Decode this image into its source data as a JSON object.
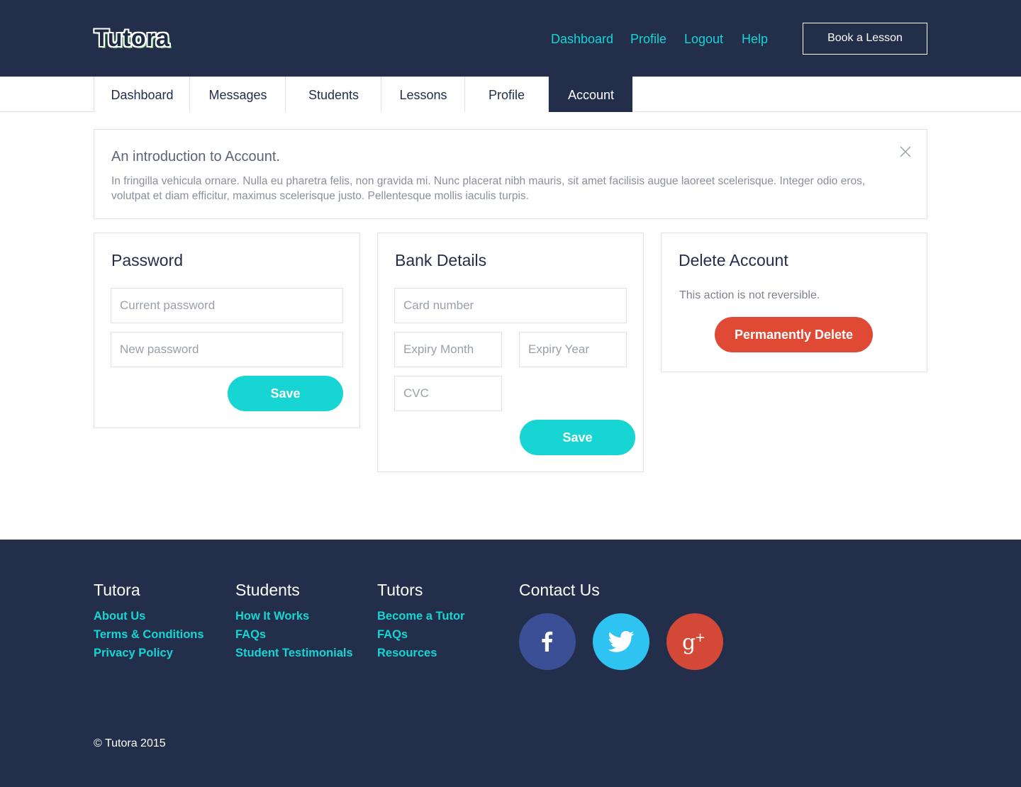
{
  "brand": {
    "logo": "Tutora"
  },
  "topnav": {
    "links": [
      "Dashboard",
      "Profile",
      "Logout",
      "Help"
    ],
    "book_label": "Book a Lesson"
  },
  "tabs": [
    {
      "label": "Dashboard",
      "active": false
    },
    {
      "label": "Messages",
      "active": false
    },
    {
      "label": "Students",
      "active": false
    },
    {
      "label": "Lessons",
      "active": false
    },
    {
      "label": "Profile",
      "active": false
    },
    {
      "label": "Account",
      "active": true
    }
  ],
  "intro": {
    "title": "An introduction to Account.",
    "body": "In fringilla vehicula ornare. Nulla eu pharetra felis, non gravida mi. Nunc placerat nibh mauris, sit amet facilisis augue laoreet scelerisque. Integer odio eros, volutpat et diam efficitur, maximus scelerisque justo. Pellentesque mollis iaculis turpis."
  },
  "password": {
    "title": "Password",
    "current_placeholder": "Current password",
    "new_placeholder": "New password",
    "save_label": "Save"
  },
  "bank": {
    "title": "Bank Details",
    "card_placeholder": "Card number",
    "month_placeholder": "Expiry Month",
    "year_placeholder": "Expiry Year",
    "cvc_placeholder": "CVC",
    "save_label": "Save"
  },
  "delete": {
    "title": "Delete Account",
    "note": "This action is not reversible.",
    "button_label": "Permanently Delete"
  },
  "footer": {
    "columns": [
      {
        "title": "Tutora",
        "links": [
          "About Us",
          "Terms & Conditions",
          "Privacy Policy"
        ]
      },
      {
        "title": "Students",
        "links": [
          "How It Works",
          "FAQs",
          "Student Testimonials"
        ]
      },
      {
        "title": "Tutors",
        "links": [
          "Become a Tutor",
          "FAQs",
          "Resources"
        ]
      }
    ],
    "contact_title": "Contact Us",
    "social": [
      {
        "icon": "facebook-icon",
        "color": "#3b4f96"
      },
      {
        "icon": "twitter-icon",
        "color": "#2ec3f1"
      },
      {
        "icon": "google-plus-icon",
        "color": "#d34836"
      }
    ],
    "copyright": "© Tutora 2015"
  },
  "colors": {
    "navy": "#232e4b",
    "teal": "#16d5d2",
    "red": "#e04a35"
  }
}
